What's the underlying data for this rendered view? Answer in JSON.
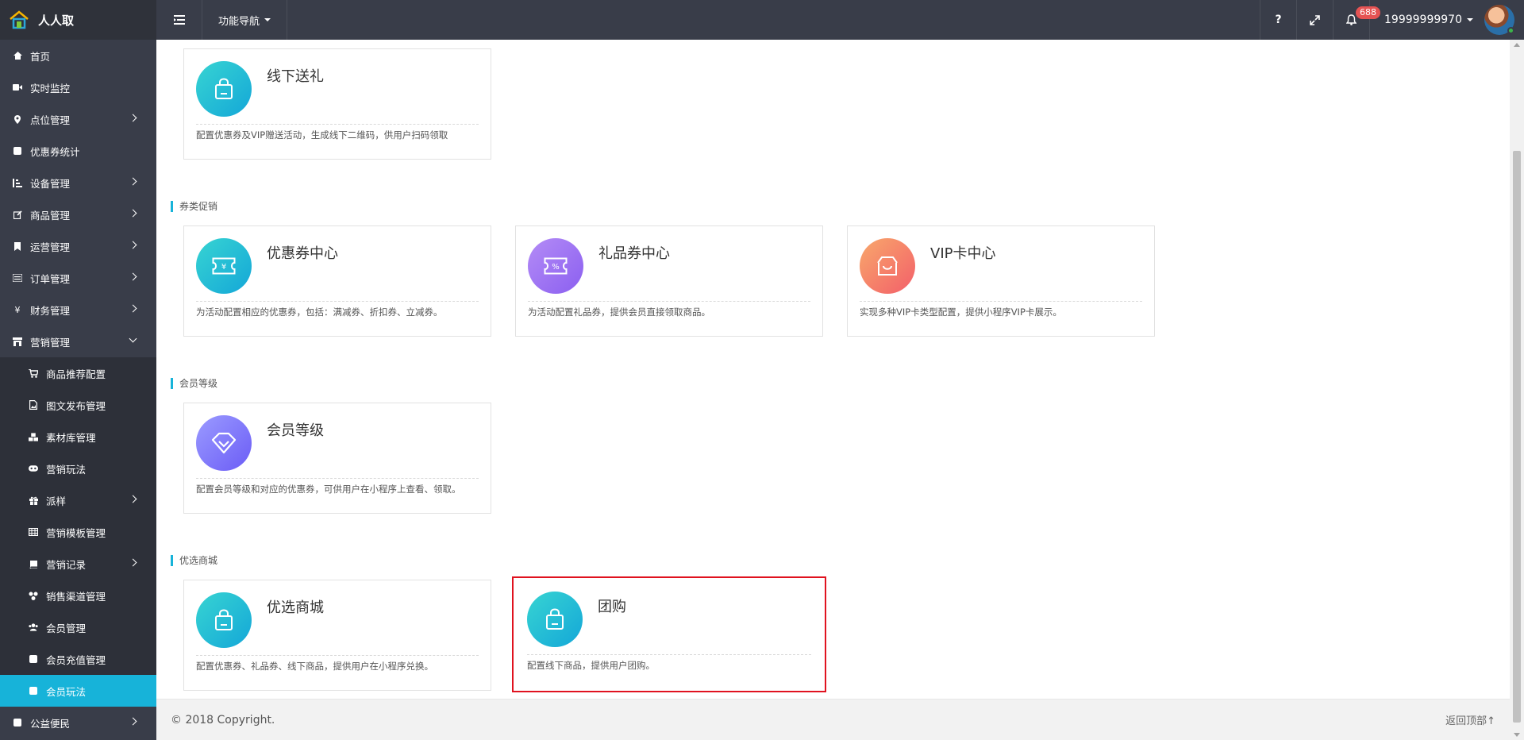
{
  "header": {
    "brand_name": "人人取",
    "nav_dropdown": "功能导航",
    "help_symbol": "?",
    "bell_count": "688",
    "username": "19999999970"
  },
  "sidebar": {
    "items": [
      {
        "label": "首页"
      },
      {
        "label": "实时监控"
      },
      {
        "label": "点位管理"
      },
      {
        "label": "优惠券统计"
      },
      {
        "label": "设备管理"
      },
      {
        "label": "商品管理"
      },
      {
        "label": "运营管理"
      },
      {
        "label": "订单管理"
      },
      {
        "label": "财务管理"
      },
      {
        "label": "营销管理"
      },
      {
        "label": "商品推荐配置"
      },
      {
        "label": "图文发布管理"
      },
      {
        "label": "素材库管理"
      },
      {
        "label": "营销玩法"
      },
      {
        "label": "派样"
      },
      {
        "label": "营销模板管理"
      },
      {
        "label": "营销记录"
      },
      {
        "label": "销售渠道管理"
      },
      {
        "label": "会员管理"
      },
      {
        "label": "会员充值管理"
      },
      {
        "label": "会员玩法"
      },
      {
        "label": "公益便民"
      }
    ]
  },
  "sections": {
    "coupon_promo": "券类促销",
    "member_level": "会员等级",
    "mall": "优选商城"
  },
  "cards": {
    "offline_gift": {
      "title": "线下送礼",
      "desc": "配置优惠券及VIP赠送活动，生成线下二维码，供用户扫码领取"
    },
    "coupon_center": {
      "title": "优惠券中心",
      "desc": "为活动配置相应的优惠券，包括：满减券、折扣券、立减券。"
    },
    "gift_coupon_center": {
      "title": "礼品券中心",
      "desc": "为活动配置礼品券，提供会员直接领取商品。"
    },
    "vip_center": {
      "title": "VIP卡中心",
      "desc": "实现多种VIP卡类型配置，提供小程序VIP卡展示。"
    },
    "member_level": {
      "title": "会员等级",
      "desc": "配置会员等级和对应的优惠券，可供用户在小程序上查看、领取。"
    },
    "mall": {
      "title": "优选商城",
      "desc": "配置优惠券、礼品券、线下商品，提供用户在小程序兑换。"
    },
    "group_buy": {
      "title": "团购",
      "desc": "配置线下商品，提供用户团购。"
    }
  },
  "footer": {
    "copyright": "© 2018 Copyright.",
    "back_top": "返回顶部↑"
  },
  "colors": {
    "topbar": "#393d49",
    "accent": "#17b3d9",
    "highlight": "#e0121f"
  }
}
